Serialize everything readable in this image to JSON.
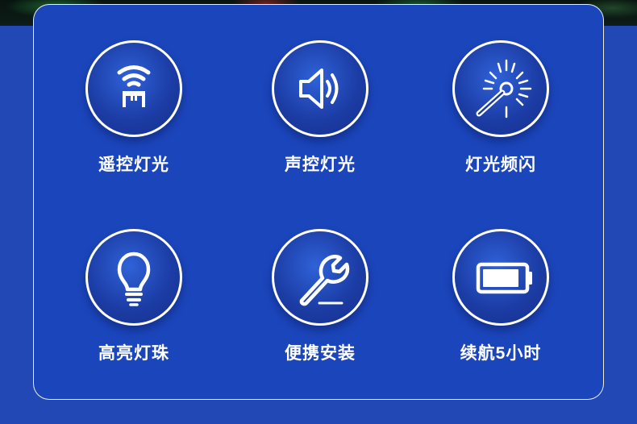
{
  "features": [
    {
      "label": "遥控灯光",
      "icon": "wifi-remote-icon"
    },
    {
      "label": "声控灯光",
      "icon": "speaker-icon"
    },
    {
      "label": "灯光频闪",
      "icon": "strobe-icon"
    },
    {
      "label": "高亮灯珠",
      "icon": "lightbulb-icon"
    },
    {
      "label": "便携安装",
      "icon": "wrench-icon"
    },
    {
      "label": "续航5小时",
      "icon": "battery-icon"
    }
  ],
  "colors": {
    "background": "#2148b4",
    "panel": "#1b45bb",
    "circle": "#1c3da6",
    "text": "#ffffff"
  }
}
